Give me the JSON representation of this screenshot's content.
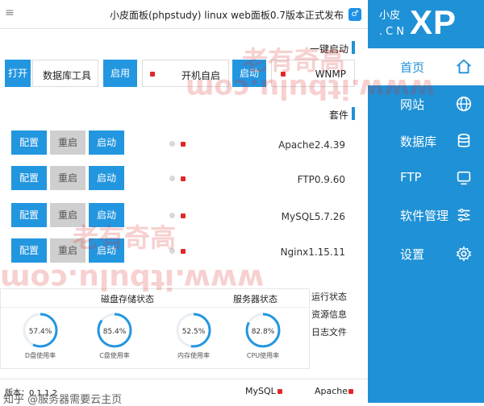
{
  "window": {
    "title": "小皮面板(phpstudy) linux web面板0.7版本正式发布",
    "menu_glyph": "≡",
    "app_icon_glyph": "♂"
  },
  "logo": {
    "brand": "XP",
    "small_1": "小皮",
    "small_2": ".CN"
  },
  "sidebar": {
    "items": [
      {
        "label": "首页",
        "icon": "home-icon",
        "active": true
      },
      {
        "label": "网站",
        "icon": "globe-icon"
      },
      {
        "label": "数据库",
        "icon": "database-icon"
      },
      {
        "label": "FTP",
        "icon": "monitor-icon"
      },
      {
        "label": "软件管理",
        "icon": "sliders-icon"
      },
      {
        "label": "设置",
        "icon": "gear-icon"
      }
    ]
  },
  "quickstart": {
    "heading": "一键启动",
    "wnmp_label": "WNMP",
    "start_button": "启动",
    "autostart_label": "开机自启",
    "autostart_button": "启用",
    "dbtool_label": "数据库工具",
    "open_button": "打开"
  },
  "suites": {
    "heading": "套件",
    "rows": [
      {
        "name": "Apache2.4.39",
        "start": "启动",
        "restart": "重启",
        "config": "配置"
      },
      {
        "name": "FTP0.9.60",
        "start": "启动",
        "restart": "重启",
        "config": "配置"
      },
      {
        "name": "MySQL5.7.26",
        "start": "启动",
        "restart": "重启",
        "config": "配置"
      },
      {
        "name": "Nginx1.15.11",
        "start": "启动",
        "restart": "重启",
        "config": "配置"
      }
    ]
  },
  "status": {
    "server_title": "服务器状态",
    "disk_title": "磁盘存储状态",
    "gauges": [
      {
        "value": "82.8%",
        "label": "CPU使用率",
        "fraction": 0.828
      },
      {
        "value": "52.5%",
        "label": "内存使用率",
        "fraction": 0.525
      },
      {
        "value": "85.4%",
        "label": "C盘使用率",
        "fraction": 0.854
      },
      {
        "value": "57.4%",
        "label": "D盘使用率",
        "fraction": 0.574
      }
    ],
    "tabs": [
      {
        "label": "运行状态"
      },
      {
        "label": "资源信息"
      },
      {
        "label": "日志文件"
      }
    ]
  },
  "footer": {
    "apache": "Apache",
    "mysql": "MySQL",
    "version": "版本：0.1.1.2",
    "zhihu": "知乎 @服务器需要云主页"
  },
  "watermarks": {
    "top_cn": "老有奇高",
    "url": "www.itbulu.com",
    "mid_cn": "老有奇高"
  },
  "colors": {
    "primary": "#1f91d6",
    "button": "#2396e0",
    "status_red": "#e02828"
  }
}
